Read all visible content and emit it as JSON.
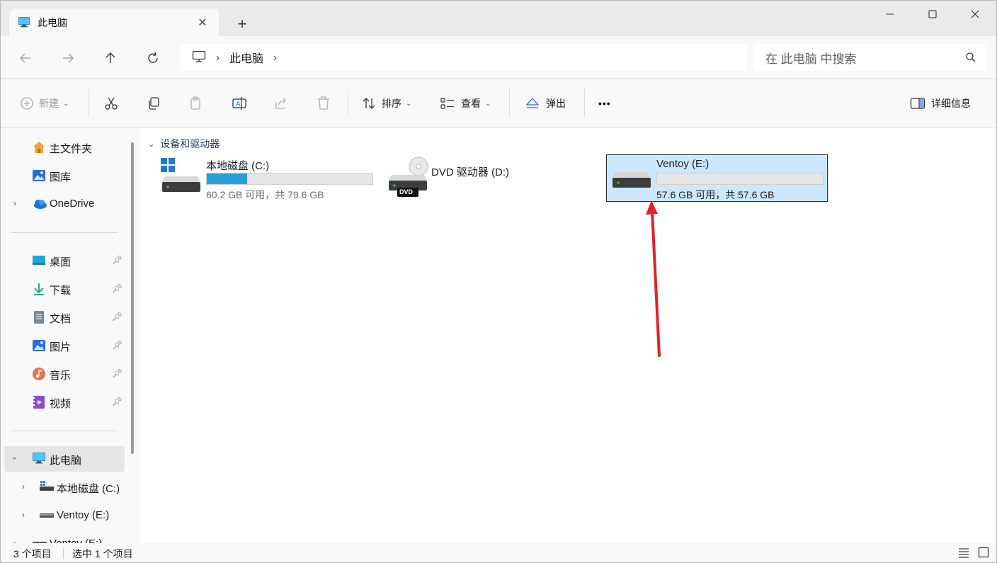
{
  "titlebar": {
    "tab_title": "此电脑",
    "close_tab": "✕",
    "new_tab": "+"
  },
  "address": {
    "crumbs": [
      "此电脑"
    ],
    "search_placeholder": "在 此电脑 中搜索"
  },
  "commands": {
    "new": "新建",
    "sort": "排序",
    "view": "查看",
    "eject": "弹出",
    "more": "•••",
    "details": "详细信息"
  },
  "sidebar": {
    "items": [
      {
        "label": "主文件夹"
      },
      {
        "label": "图库"
      },
      {
        "label": "OneDrive"
      },
      {
        "label": "桌面"
      },
      {
        "label": "下载"
      },
      {
        "label": "文档"
      },
      {
        "label": "图片"
      },
      {
        "label": "音乐"
      },
      {
        "label": "视频"
      },
      {
        "label": "此电脑"
      },
      {
        "label": "本地磁盘 (C:)"
      },
      {
        "label": "Ventoy (E:)"
      },
      {
        "label": "Ventoy (E:)"
      }
    ]
  },
  "content": {
    "group_title": "设备和驱动器",
    "drives": [
      {
        "name": "本地磁盘 (C:)",
        "info": "60.2 GB 可用，共 79.6 GB",
        "used_fraction": 0.244
      },
      {
        "name": "DVD 驱动器 (D:)",
        "badge": "DVD"
      },
      {
        "name": "Ventoy (E:)",
        "info": "57.6 GB 可用，共 57.6 GB",
        "used_fraction": 0.0
      }
    ]
  },
  "status": {
    "count": "3 个项目",
    "selected": "选中 1 个项目"
  },
  "colors": {
    "accent": "#26a0da",
    "selection": "#cce8ff",
    "arrow": "#e0202a"
  }
}
